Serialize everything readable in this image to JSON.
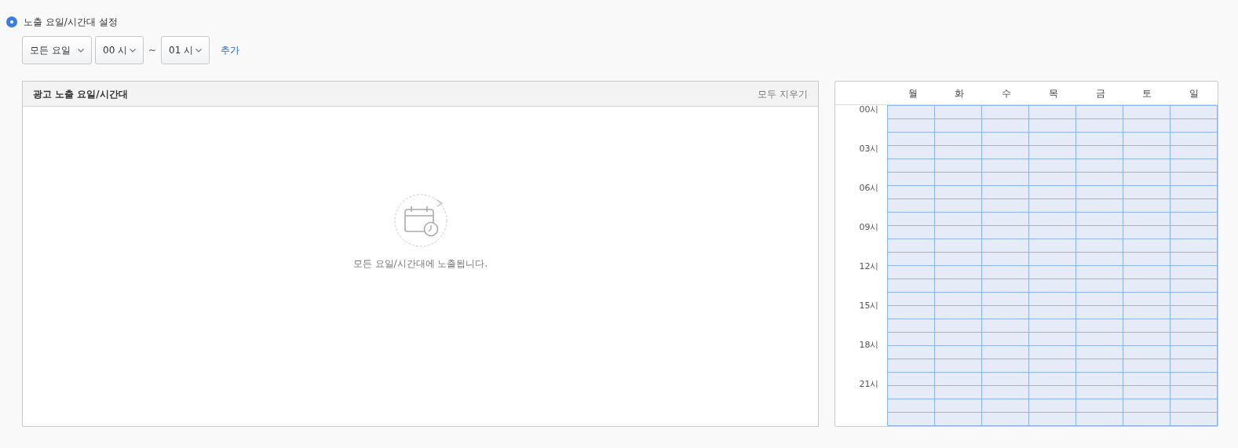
{
  "option": {
    "label": "노출 요일/시간대 설정",
    "selected": true
  },
  "controls": {
    "day_select": "모든 요일",
    "start_select": "00 시",
    "separator": "~",
    "end_select": "01 시",
    "add_link": "추가"
  },
  "list_panel": {
    "title": "광고 노출 요일/시간대",
    "clear_all": "모두 지우기",
    "empty_message": "모든 요일/시간대에 노출됩니다."
  },
  "schedule_grid": {
    "days": [
      "월",
      "화",
      "수",
      "목",
      "금",
      "토",
      "일"
    ],
    "hour_labels": [
      "00시",
      "03시",
      "06시",
      "09시",
      "12시",
      "15시",
      "18시",
      "21시"
    ]
  }
}
